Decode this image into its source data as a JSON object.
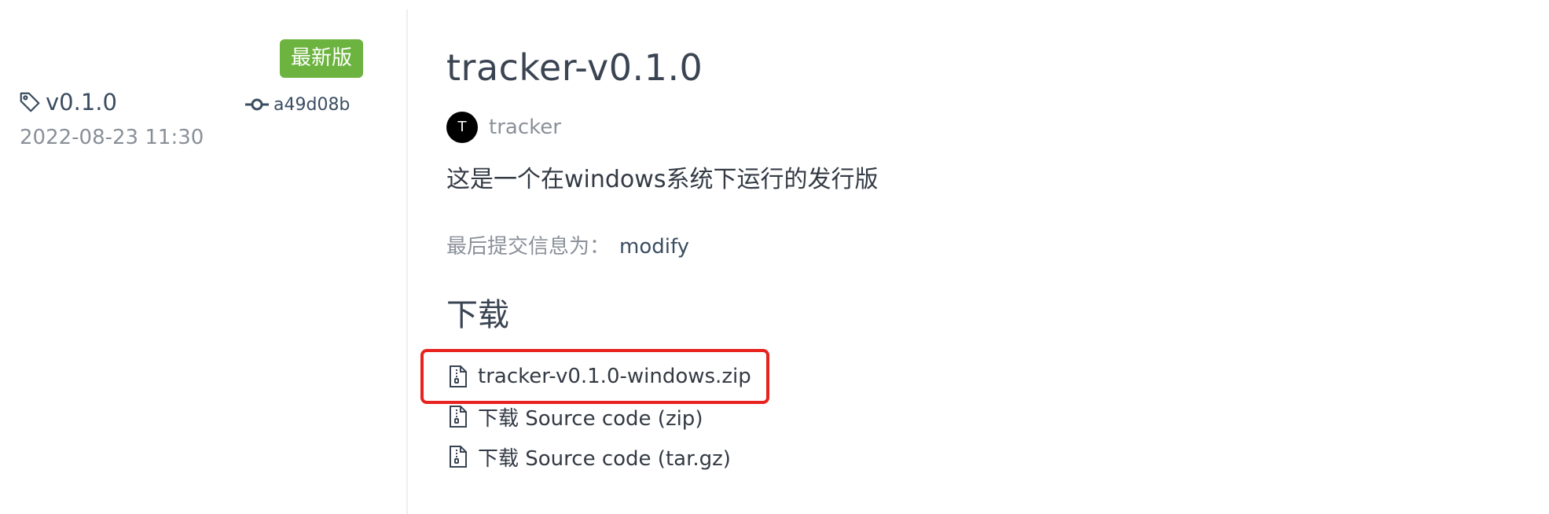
{
  "sidebar": {
    "latest_badge": "最新版",
    "tag": {
      "icon": "tag-icon",
      "label": "v0.1.0"
    },
    "commit": {
      "icon": "commit-icon",
      "hash": "a49d08b"
    },
    "date": "2022-08-23 11:30"
  },
  "release": {
    "title": "tracker-v0.1.0",
    "author": {
      "avatar_initial": "T",
      "name": "tracker"
    },
    "description": "这是一个在windows系统下运行的发行版",
    "commit_message": {
      "label": "最后提交信息为：",
      "value": "modify"
    },
    "downloads_heading": "下载",
    "downloads": [
      {
        "icon": "zip-file-icon",
        "label": "tracker-v0.1.0-windows.zip",
        "highlighted": true
      },
      {
        "icon": "zip-file-icon",
        "label": "下载 Source code (zip)"
      },
      {
        "icon": "zip-file-icon",
        "label": "下载 Source code (tar.gz)"
      }
    ]
  },
  "colors": {
    "badge_green": "#6cb33f",
    "highlight_red": "#e8231f",
    "link_blue": "#3a4d61",
    "muted_gray": "#8a9099"
  }
}
